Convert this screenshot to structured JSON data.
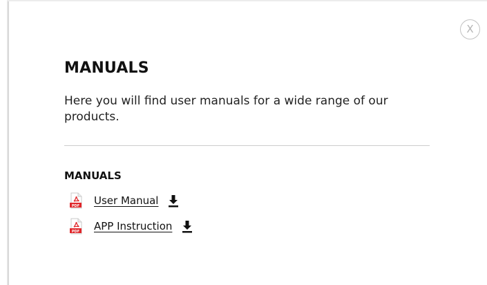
{
  "modal": {
    "close_label": "X",
    "title": "MANUALS",
    "description": "Here you will find user manuals for a wide range of our products.",
    "section_heading": "MANUALS",
    "files": [
      {
        "label": "User Manual",
        "icon": "pdf-file-icon",
        "action_icon": "download-icon"
      },
      {
        "label": "APP Instruction",
        "icon": "pdf-file-icon",
        "action_icon": "download-icon"
      }
    ],
    "pdf_icon_text": "PDF"
  },
  "colors": {
    "pdf_red": "#e0262a",
    "text": "#111111",
    "divider": "#cccccc",
    "close_gray": "#b4b4b4"
  }
}
